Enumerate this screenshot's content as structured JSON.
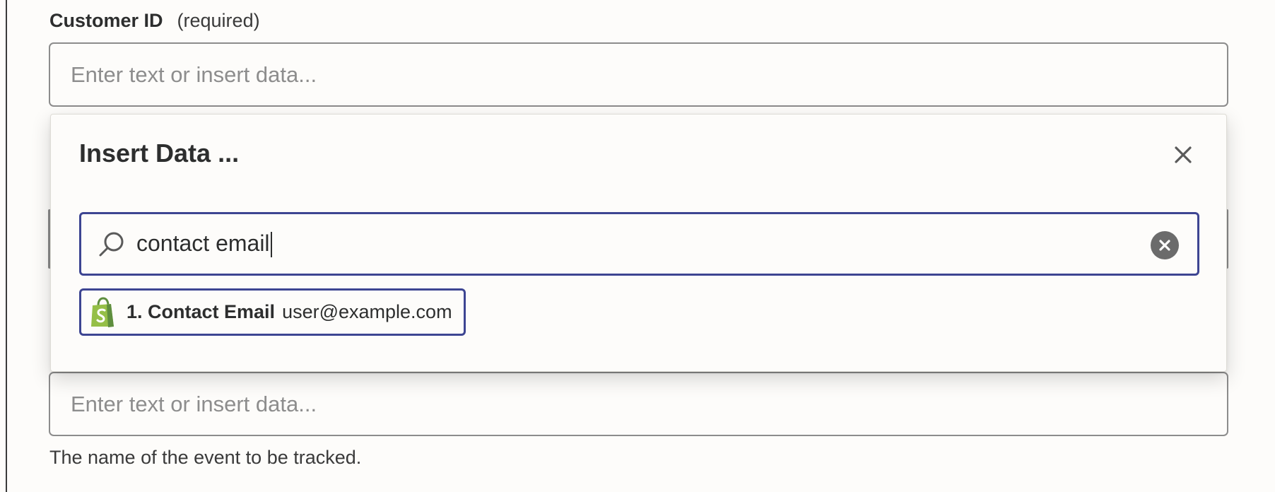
{
  "customer_id": {
    "label": "Customer ID",
    "required": "(required)",
    "placeholder": "Enter text or insert data..."
  },
  "event_field": {
    "placeholder": "Enter text or insert data...",
    "help": "The name of the event to be tracked."
  },
  "insert_data": {
    "title": "Insert Data ...",
    "search_value": "contact email",
    "results": [
      {
        "app_icon": "shopify-bag-icon",
        "label": "1. Contact Email",
        "value": "user@example.com"
      }
    ]
  },
  "colors": {
    "focus_border": "#3d4592",
    "shopify_green": "#95bf47",
    "shopify_dark_green": "#5e8e3e"
  }
}
